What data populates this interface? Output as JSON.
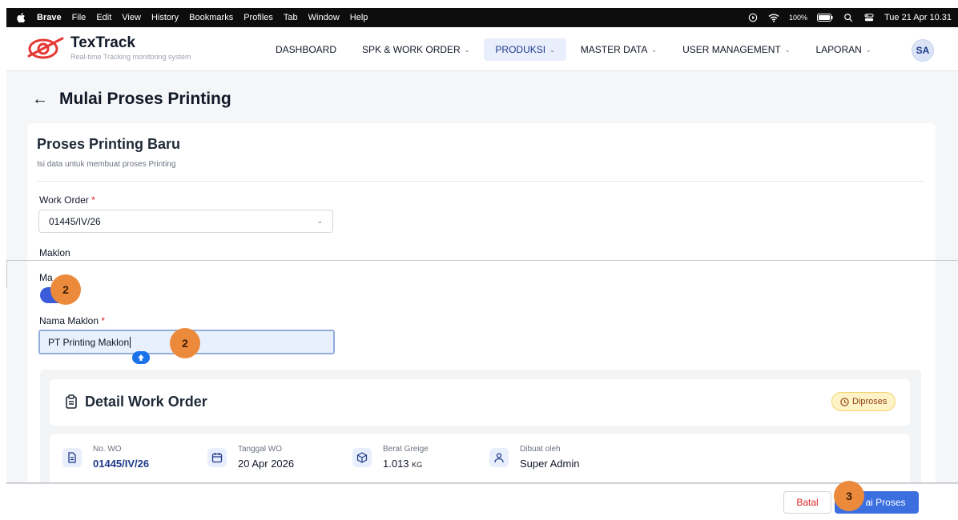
{
  "menubar": {
    "app": "Brave",
    "items": [
      "File",
      "Edit",
      "View",
      "History",
      "Bookmarks",
      "Profiles",
      "Tab",
      "Window",
      "Help"
    ],
    "battery": "100%",
    "datetime": "Tue 21 Apr 10.31"
  },
  "brand": {
    "name": "TexTrack",
    "tagline": "Real-time Tracking monitoring system",
    "accent": "#e53935"
  },
  "nav": {
    "items": [
      {
        "label": "DASHBOARD"
      },
      {
        "label": "SPK & WORK ORDER"
      },
      {
        "label": "PRODUKSI"
      },
      {
        "label": "MASTER DATA"
      },
      {
        "label": "USER MANAGEMENT"
      },
      {
        "label": "LAPORAN"
      }
    ],
    "avatar": "SA"
  },
  "page": {
    "title": "Mulai Proses Printing"
  },
  "form": {
    "title": "Proses Printing Baru",
    "subtitle": "Isi data untuk membuat proses Printing",
    "work_order_label": "Work Order",
    "work_order_value": "01445/IV/26",
    "maklon_label": "Maklon",
    "maklon_toggle_label": "Ma",
    "maklon_enabled": true,
    "nama_maklon_label": "Nama Maklon",
    "nama_maklon_value": "PT Printing Maklon",
    "required_mark": "*"
  },
  "detail": {
    "title": "Detail Work Order",
    "status": "Diproses",
    "status_color": "#fdf3c7",
    "fields": [
      {
        "label": "No. WO",
        "value": "01445/IV/26",
        "icon": "document-icon"
      },
      {
        "label": "Tanggal WO",
        "value": "20 Apr 2026",
        "icon": "calendar-icon"
      },
      {
        "label": "Berat Greige",
        "value": "1.013",
        "unit": "KG",
        "icon": "box-icon"
      },
      {
        "label": "Dibuat oleh",
        "value": "Super Admin",
        "icon": "user-icon"
      }
    ]
  },
  "footer": {
    "cancel_label": "Batal",
    "submit_label": "ai Proses",
    "primary_color": "#3b6fe0"
  },
  "annotations": {
    "badge_a": "2",
    "badge_b": "2",
    "badge_c": "3"
  }
}
